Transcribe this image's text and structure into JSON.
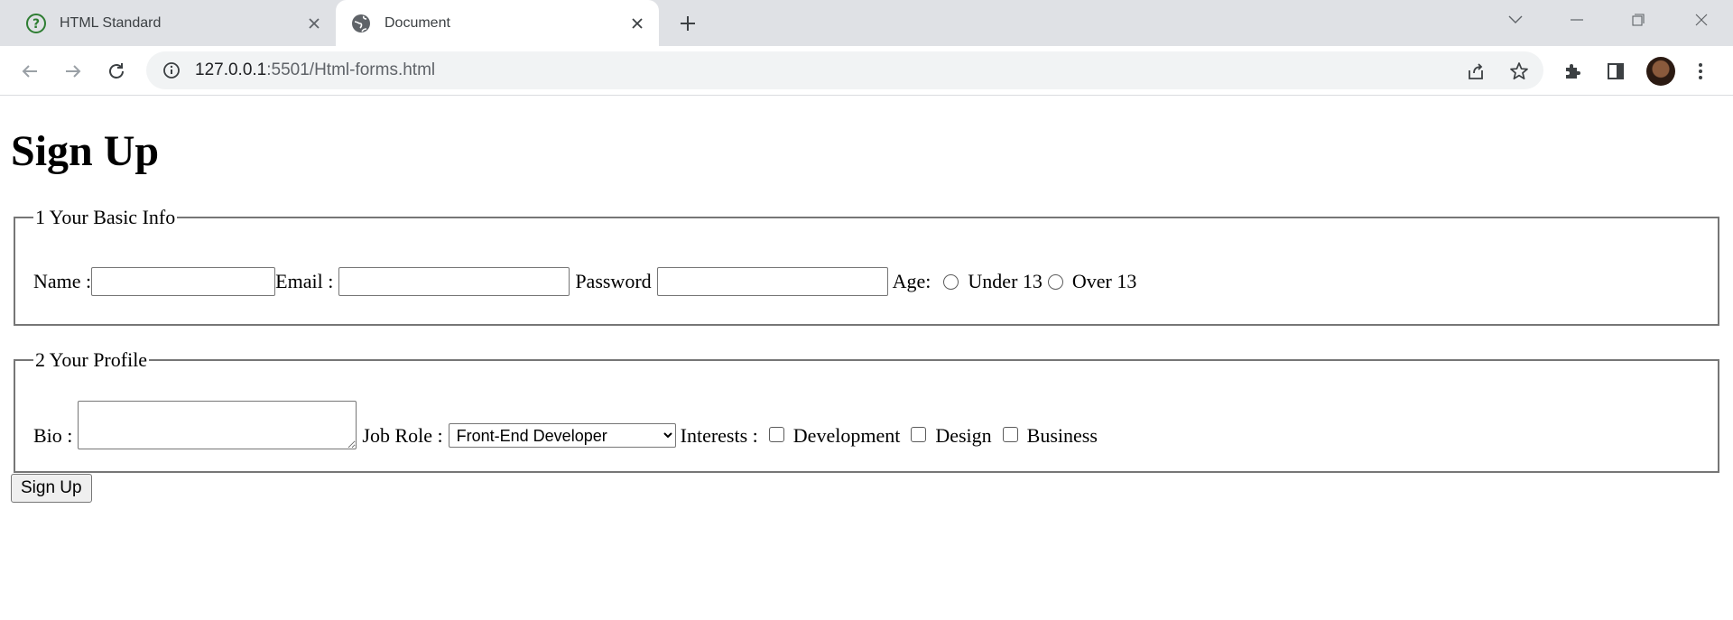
{
  "browser": {
    "tabs": [
      {
        "title": "HTML Standard",
        "icon": "help-circle-icon",
        "active": false
      },
      {
        "title": "Document",
        "icon": "globe-icon",
        "active": true
      }
    ],
    "url_host": "127.0.0.1",
    "url_rest": ":5501/Html-forms.html"
  },
  "page": {
    "heading": "Sign Up",
    "basic_info": {
      "legend": "1 Your Basic Info",
      "name_label": "Name :",
      "email_label": "Email :",
      "password_label": "Password",
      "age_label": "Age:",
      "age_under": "Under 13",
      "age_over": "Over 13"
    },
    "profile": {
      "legend": "2 Your Profile",
      "bio_label": "Bio :",
      "job_label": "Job Role :",
      "job_selected": "Front-End Developer",
      "interests_label": "Interests :",
      "interest_1": "Development",
      "interest_2": "Design",
      "interest_3": "Business"
    },
    "submit_label": "Sign Up"
  }
}
